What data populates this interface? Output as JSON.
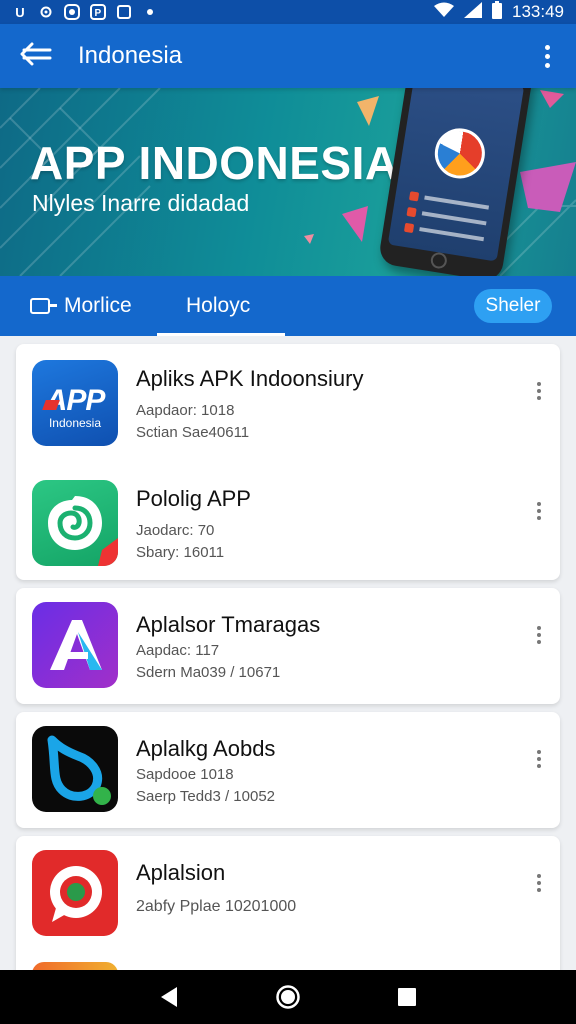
{
  "status_bar": {
    "icons": [
      "u-icon",
      "settings-icon",
      "record-icon",
      "p-icon",
      "box-icon",
      "dot-icon"
    ],
    "right_icons": [
      "wifi-icon",
      "signal-icon",
      "battery-icon"
    ],
    "time": "133:49"
  },
  "app_bar": {
    "title": "Indonesia"
  },
  "banner": {
    "title": "APP INDONESIA",
    "subtitle": "Nlyles Inarre didadad"
  },
  "tabs": {
    "mobile": "Morlice",
    "history": "Holoyc",
    "share": "Sheler"
  },
  "apps": [
    {
      "name": "Apliks APK Indoonsiury",
      "meta1": "Aapdaor: 1018",
      "meta2": "Sctian Sae40611",
      "icon_text": "APP",
      "icon_sub": "Indonesia"
    },
    {
      "name": "Pololig APP",
      "meta1": "Jaodarc: 70",
      "meta2": "Sbary: 16011"
    },
    {
      "name": "Aplalsor Tmaragas",
      "meta1": "Aapdac: 117",
      "meta2": "Sdern Ma039 / 10671"
    },
    {
      "name": "Aplalkg Aobds",
      "meta1": "Sapdooe 1018",
      "meta2": "Saerp Tedd3 / 10052"
    },
    {
      "name": "Aplalsion",
      "meta1": "2abfy Pplae 10201000"
    }
  ],
  "colors": {
    "primary": "#1468cc",
    "status": "#0d4fa8",
    "accent": "#2ea0f2"
  }
}
